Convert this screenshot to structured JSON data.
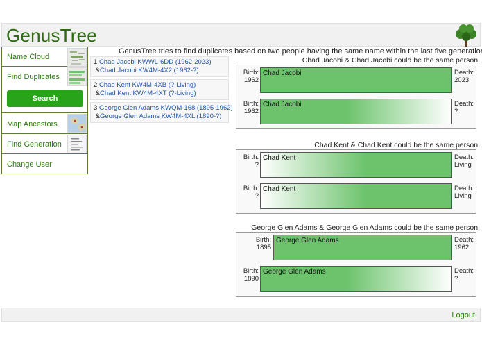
{
  "header": {
    "title": "GenusTree"
  },
  "sidebar": {
    "items": [
      {
        "label": "Name Cloud"
      },
      {
        "label": "Find Duplicates",
        "button": "Search"
      },
      {
        "label": "Map Ancestors"
      },
      {
        "label": "Find Generation"
      },
      {
        "label": "Change User"
      }
    ]
  },
  "intro": "GenusTree tries to find duplicates based on two people having the same name within the last five generations.",
  "duplicates": [
    {
      "index": "1",
      "first": "Chad Jacobi KWWL-6DD (1962-2023)",
      "second": "Chad Jacobi KW4M-4X2 (1962-?)"
    },
    {
      "index": "2",
      "first": "Chad Kent KW4M-4XB (?-Living)",
      "second": "Chad Kent KW4M-4XT (?-Living)"
    },
    {
      "index": "3",
      "first": "George Glen Adams KWQM-168 (1895-1962)",
      "second": "George Glen Adams KW4M-4XL (1890-?)"
    }
  ],
  "comparisons": [
    {
      "title": "Chad Jacobi & Chad Jacobi could be the same person.",
      "rows": [
        {
          "birth_label": "Birth:",
          "birth": "1962",
          "name": "Chad Jacobi",
          "death_label": "Death:",
          "death": "2023",
          "known": true
        },
        {
          "birth_label": "Birth:",
          "birth": "1962",
          "name": "Chad Jacobi",
          "death_label": "Death:",
          "death": "?",
          "known": false
        }
      ]
    },
    {
      "title": "Chad Kent & Chad Kent could be the same person.",
      "rows": [
        {
          "birth_label": "Birth:",
          "birth": "?",
          "name": "Chad Kent",
          "death_label": "Death:",
          "death": "Living",
          "known": false
        },
        {
          "birth_label": "Birth:",
          "birth": "?",
          "name": "Chad Kent",
          "death_label": "Death:",
          "death": "Living",
          "known": false
        }
      ]
    },
    {
      "title": "George Glen Adams & George Glen Adams could be the same person.",
      "rows": [
        {
          "birth_label": "Birth:",
          "birth": "1895",
          "name": "George Glen Adams",
          "death_label": "Death:",
          "death": "1962",
          "known": true
        },
        {
          "birth_label": "Birth:",
          "birth": "1890",
          "name": "George Glen Adams",
          "death_label": "Death:",
          "death": "?",
          "known": false
        }
      ]
    }
  ],
  "footer": {
    "logout": "Logout"
  },
  "colors": {
    "brand": "#2e6b12",
    "button": "#29a319",
    "bar": "#6cc36c",
    "link": "#2255aa"
  }
}
